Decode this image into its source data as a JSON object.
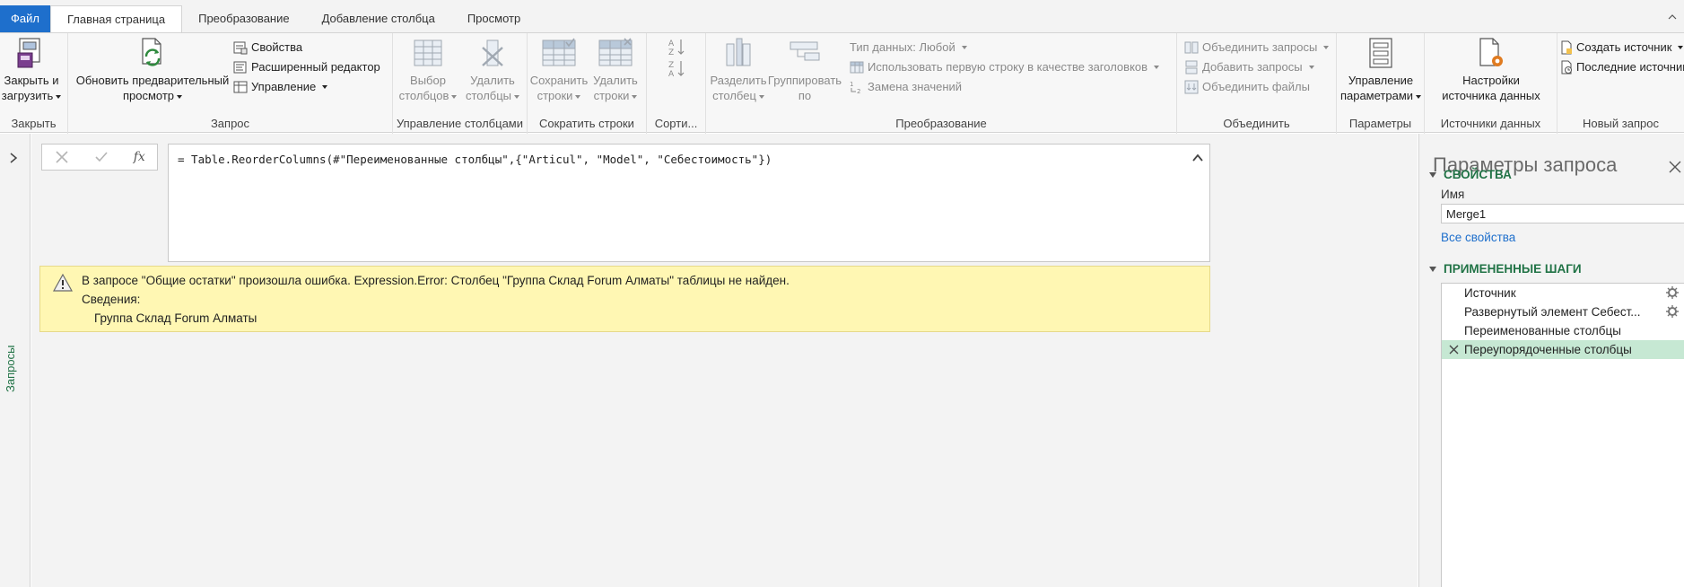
{
  "tabs": [
    {
      "label": "Файл"
    },
    {
      "label": "Главная страница"
    },
    {
      "label": "Преобразование"
    },
    {
      "label": "Добавление столбца"
    },
    {
      "label": "Просмотр"
    }
  ],
  "ribbon": {
    "close": {
      "line1": "Закрыть и",
      "line2": "загрузить",
      "group": "Закрыть"
    },
    "query": {
      "refresh_line1": "Обновить предварительный",
      "refresh_line2": "просмотр",
      "properties": "Свойства",
      "advanced_editor": "Расширенный редактор",
      "manage": "Управление",
      "group": "Запрос"
    },
    "manage_columns": {
      "choose_line1": "Выбор",
      "choose_line2": "столбцов",
      "remove_line1": "Удалить",
      "remove_line2": "столбцы",
      "group": "Управление столбцами"
    },
    "reduce_rows": {
      "keep_line1": "Сохранить",
      "keep_line2": "строки",
      "remove_line1": "Удалить",
      "remove_line2": "строки",
      "group": "Сократить строки"
    },
    "sort": {
      "group": "Сорти..."
    },
    "transform": {
      "split_line1": "Разделить",
      "split_line2": "столбец",
      "group_by_line1": "Группировать",
      "group_by_line2": "по",
      "data_type": "Тип данных: Любой",
      "use_first_row": "Использовать первую строку в качестве заголовков",
      "replace_values": "Замена значений",
      "group": "Преобразование"
    },
    "combine": {
      "merge": "Объединить запросы",
      "append": "Добавить запросы",
      "combine_files": "Объединить файлы",
      "group": "Объединить"
    },
    "parameters": {
      "line1": "Управление",
      "line2": "параметрами",
      "group": "Параметры"
    },
    "data_sources": {
      "line1": "Настройки",
      "line2": "источника данных",
      "group": "Источники данных"
    },
    "new_query": {
      "new_source": "Создать источник",
      "recent_sources": "Последние источники",
      "group": "Новый запрос"
    }
  },
  "left_pane": {
    "label": "Запросы"
  },
  "formula_bar": {
    "fx": "fx",
    "formula": "= Table.ReorderColumns(#\"Переименованные столбцы\",{\"Articul\", \"Model\", \"Себестоимость\"})"
  },
  "error": {
    "message": "В запросе \"Общие остатки\" произошла ошибка. Expression.Error: Столбец \"Группа Склад Forum Алматы\" таблицы не найден.",
    "details_label": "Сведения:",
    "details_value": "Группа Склад Forum Алматы"
  },
  "query_settings": {
    "title": "Параметры запроса",
    "properties_header": "СВОЙСТВА",
    "name_label": "Имя",
    "name_value": "Merge1",
    "all_properties": "Все свойства",
    "steps_header": "ПРИМЕНЕННЫЕ ШАГИ",
    "steps": [
      {
        "label": "Источник",
        "has_gear": true
      },
      {
        "label": "Развернутый элемент Себест...",
        "has_gear": true
      },
      {
        "label": "Переименованные столбцы",
        "has_gear": false
      },
      {
        "label": "Переупорядоченные столбцы",
        "has_gear": false,
        "selected": true
      }
    ]
  },
  "colors": {
    "accent_green": "#217346",
    "file_tab_blue": "#1e6fcc",
    "error_bg": "#fff7b3",
    "selected_step": "#c6e8d3"
  }
}
